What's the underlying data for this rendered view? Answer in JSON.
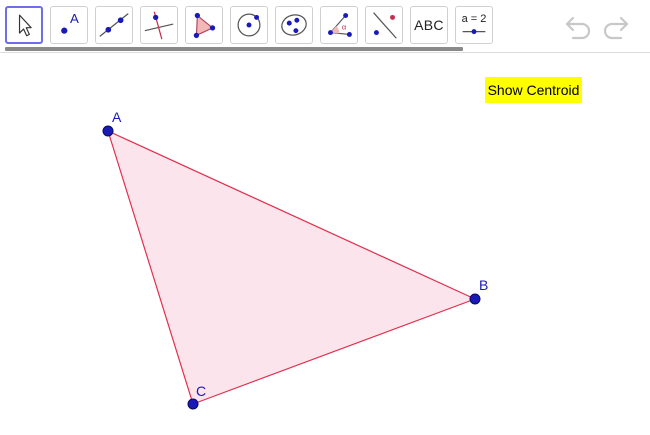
{
  "toolbar": {
    "tools": [
      {
        "name": "Move",
        "icon": "cursor-arrow-icon",
        "selected": true
      },
      {
        "name": "Point",
        "icon": "point-icon",
        "glyph": "A"
      },
      {
        "name": "Line",
        "icon": "line-icon"
      },
      {
        "name": "Perpendicular Line",
        "icon": "perpendicular-line-icon"
      },
      {
        "name": "Polygon",
        "icon": "polygon-icon"
      },
      {
        "name": "Circle with Center through Point",
        "icon": "circle-icon"
      },
      {
        "name": "Ellipse",
        "icon": "ellipse-icon"
      },
      {
        "name": "Angle",
        "icon": "angle-icon",
        "glyph": "α"
      },
      {
        "name": "Reflect about Line",
        "icon": "reflect-icon"
      },
      {
        "name": "Text",
        "icon": "text-icon",
        "label": "ABC"
      },
      {
        "name": "Slider",
        "icon": "slider-icon",
        "label": "a = 2"
      }
    ],
    "undo_icon": "undo-icon",
    "redo_icon": "redo-icon"
  },
  "canvas": {
    "button": {
      "label": "Show Centroid",
      "color": "#ffff00"
    },
    "triangle": {
      "fill": "#fce4ec",
      "stroke": "#e0304e",
      "point_color": "#1a1ab8"
    },
    "points": [
      {
        "label": "A"
      },
      {
        "label": "B"
      },
      {
        "label": "C"
      }
    ]
  },
  "colors": {
    "selected_border": "#6e6ee6",
    "point": "#1a1ab8",
    "polygon_edge": "#e0304e"
  }
}
